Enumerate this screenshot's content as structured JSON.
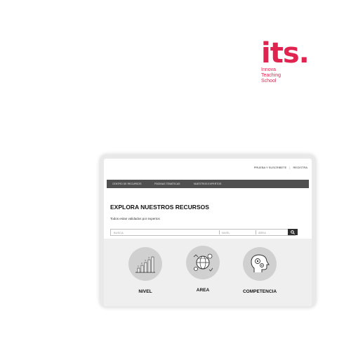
{
  "logo": {
    "mark": "its.",
    "line1": "Innova",
    "line2": "Teaching",
    "line3": "School",
    "color": "#e0234f"
  },
  "topbar": {
    "links": [
      "PRUEBA Y SUSCRIBETE",
      "|",
      "REGISTRA"
    ]
  },
  "nav": {
    "items": [
      "CENTRO DE RECURSOS",
      "PÁGINAS TEMÁTICAS",
      "NUESTROS EXPERTOS"
    ]
  },
  "main": {
    "title": "EXPLORA NUESTROS RECURSOS",
    "subtitle": "Todos estan validados por expertos"
  },
  "search": {
    "query_placeholder": "BUSCA",
    "level_placeholder": "NIVEL",
    "area_placeholder": "ÁREA",
    "button_icon": "search-icon"
  },
  "categories": [
    {
      "label": "NIVEL",
      "icon": "bar-steps-icon"
    },
    {
      "label": "AREA",
      "icon": "globe-gear-icon"
    },
    {
      "label": "COMPETENCIA",
      "icon": "head-gears-icon"
    }
  ]
}
